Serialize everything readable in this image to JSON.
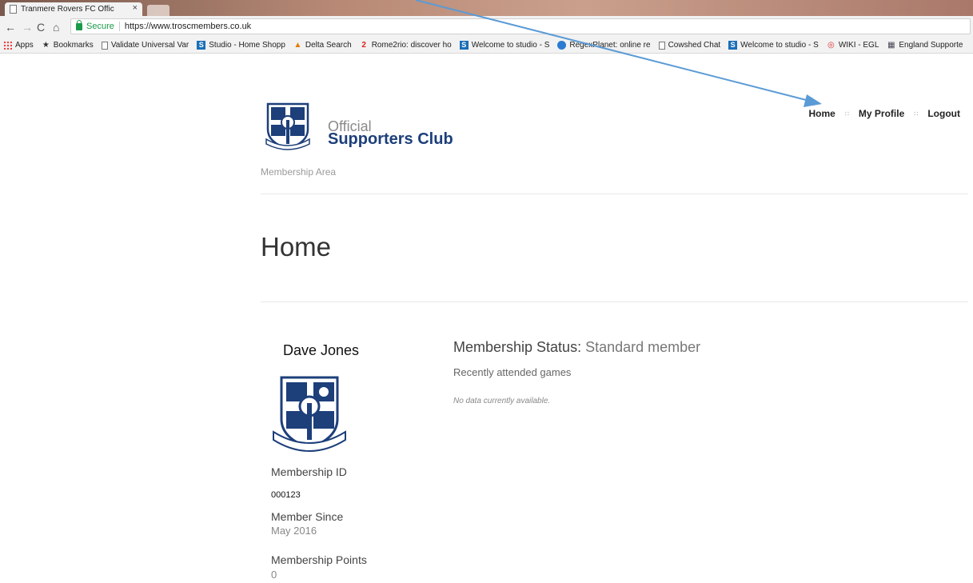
{
  "browser": {
    "tab_title": "Tranmere Rovers FC Offic",
    "tab_close": "×",
    "secure_label": "Secure",
    "url": "https://www.troscmembers.co.uk",
    "bookmarks": [
      {
        "icon": "apps-icon",
        "label": "Apps"
      },
      {
        "icon": "star-icon",
        "label": "Bookmarks"
      },
      {
        "icon": "page-icon",
        "label": "Validate Universal Var"
      },
      {
        "icon": "studio-icon",
        "label": "Studio - Home Shopp"
      },
      {
        "icon": "delta-icon",
        "label": "Delta Search"
      },
      {
        "icon": "rome2rio-icon",
        "label": "Rome2rio: discover ho"
      },
      {
        "icon": "studio-icon",
        "label": "Welcome to studio - S"
      },
      {
        "icon": "globe-icon",
        "label": "RegexPlanet: online re"
      },
      {
        "icon": "page-icon",
        "label": "Cowshed Chat"
      },
      {
        "icon": "studio-icon",
        "label": "Welcome to studio - S"
      },
      {
        "icon": "wiki-icon",
        "label": "WIKI - EGL"
      },
      {
        "icon": "england-icon",
        "label": "England Supporte"
      }
    ]
  },
  "header": {
    "brand_small": "Official",
    "brand_big": "Supporters Club",
    "subtitle": "Membership Area",
    "nav": [
      {
        "label": "Home"
      },
      {
        "label": "My Profile"
      },
      {
        "label": "Logout"
      }
    ]
  },
  "main": {
    "title": "Home",
    "member": {
      "name": "Dave Jones",
      "id_label": "Membership ID",
      "id_value": "000123",
      "since_label": "Member Since",
      "since_value": "May 2016",
      "points_label": "Membership Points",
      "points_value": "0"
    },
    "status_label": "Membership Status:",
    "status_value": "Standard member",
    "recent_label": "Recently attended games",
    "no_data": "No data currently available."
  },
  "colors": {
    "brand_blue": "#1d3f7a",
    "secure_green": "#1a9b4a",
    "annotation_arrow": "#5b9bd5"
  }
}
